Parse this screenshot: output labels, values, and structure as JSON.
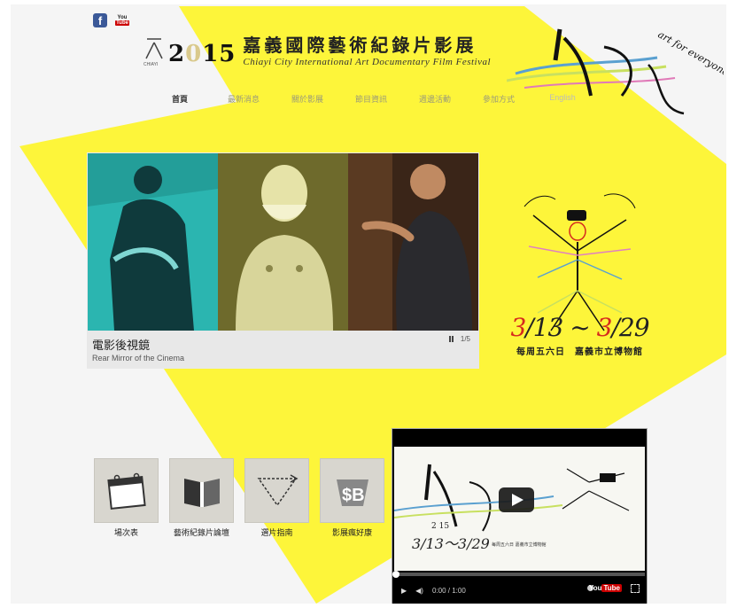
{
  "social": {
    "facebook_glyph": "f",
    "youtube_glyph_top": "You",
    "youtube_glyph_bottom": "Tube"
  },
  "brand": {
    "logo_text": "CHIAYI",
    "year_parts": [
      "2",
      "0",
      "1",
      "5"
    ],
    "title_zh": "嘉義國際藝術紀錄片影展",
    "title_en": "Chiayi City International Art Documentary Film Festival"
  },
  "nav": [
    {
      "label": "首頁",
      "active": true
    },
    {
      "label": "最新消息"
    },
    {
      "label": "關於影展"
    },
    {
      "label": "節目資訊"
    },
    {
      "label": "週邊活動"
    },
    {
      "label": "參加方式"
    },
    {
      "label": "English"
    }
  ],
  "slider": {
    "caption_zh": "電影後視鏡",
    "caption_en": "Rear Mirror of the Cinema",
    "page_indicator": "1/5"
  },
  "event": {
    "dates_start_prefix": "3",
    "dates_start_rest": "/13",
    "dates_tilde": "~",
    "dates_end_prefix": "3",
    "dates_end_rest": "/29",
    "subtitle": "每周五六日　嘉義市立博物館"
  },
  "deco": {
    "brush_text": "art for everyone"
  },
  "links": [
    {
      "label": "場次表",
      "icon": "calendar-icon"
    },
    {
      "label": "藝術紀錄片論壇",
      "icon": "book-icon"
    },
    {
      "label": "選片指南",
      "icon": "triangle-arrow-icon"
    },
    {
      "label": "影展瘋好康",
      "icon": "dollar-cart-icon"
    }
  ],
  "video": {
    "time": "0:00 / 1:00",
    "youtube_label_a": "You",
    "youtube_label_b": "Tube",
    "thumb_year": "2 15",
    "thumb_dates": "3/13～3/29",
    "thumb_info": "每周五六日 嘉義市立博物館"
  },
  "colors": {
    "accent_yellow": "#fdf53a",
    "date_red": "#d62a1e",
    "teal_photo": "#2bb5b0"
  }
}
